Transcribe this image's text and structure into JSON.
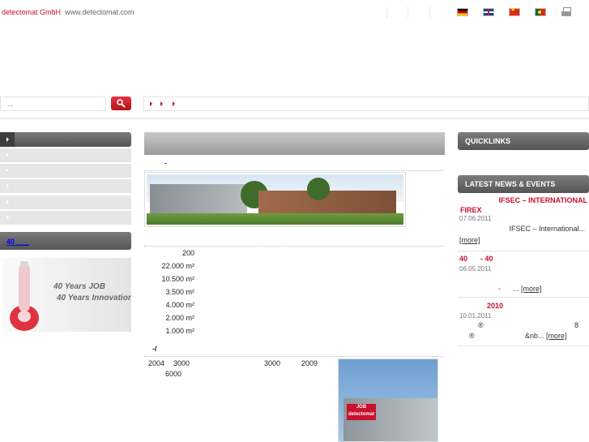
{
  "header": {
    "company": "detectomat GmbH",
    "website": "www.detectomat.com"
  },
  "languages": [
    {
      "name": "de-flag-icon"
    },
    {
      "name": "gb-flag-icon"
    },
    {
      "name": "cn-flag-icon"
    },
    {
      "name": "pt-flag-icon"
    }
  ],
  "search": {
    "placeholder": "...",
    "icon": "search-icon"
  },
  "left_nav": {
    "promo_label": "40 ___",
    "promo_image_text": [
      "40 Years JOB",
      "40 Years Innovation"
    ]
  },
  "main": {
    "marker": "-",
    "facts": [
      "200",
      "22.000 m²",
      "10.500 m²",
      "3.500 m²",
      "4.000 m²",
      "2.000 m²",
      "1.000 m²"
    ],
    "history_marker": "-/",
    "history": {
      "y2004": "2004",
      "v3000a": "3000",
      "v6000": "6000",
      "v3000b": "3000",
      "y2009": "2009"
    },
    "photo_logo": "JOB detectomat"
  },
  "right": {
    "quicklinks_title": "QUICKLINKS",
    "news_title": "LATEST NEWS & EVENTS",
    "news": [
      {
        "title_a": "IFSEC – INTERNATIONAL",
        "title_b": "FIREX",
        "date": "07.06.2011",
        "text": "IFSEC – International...",
        "more": "[more]"
      },
      {
        "title_a": "40",
        "title_b": "- 40",
        "date": "06.05.2011",
        "text_a": "-",
        "text_b": "...",
        "more": "[more]"
      },
      {
        "title": "2010",
        "date": "10.01.2011",
        "sym_a": "®",
        "sym_b": "8",
        "sym_c": "®",
        "text": "&nb...",
        "more": "[more]"
      }
    ]
  },
  "colors": {
    "accent": "#c8102e",
    "nav_dark": "#555555",
    "nav_light": "#e6e6e6"
  }
}
